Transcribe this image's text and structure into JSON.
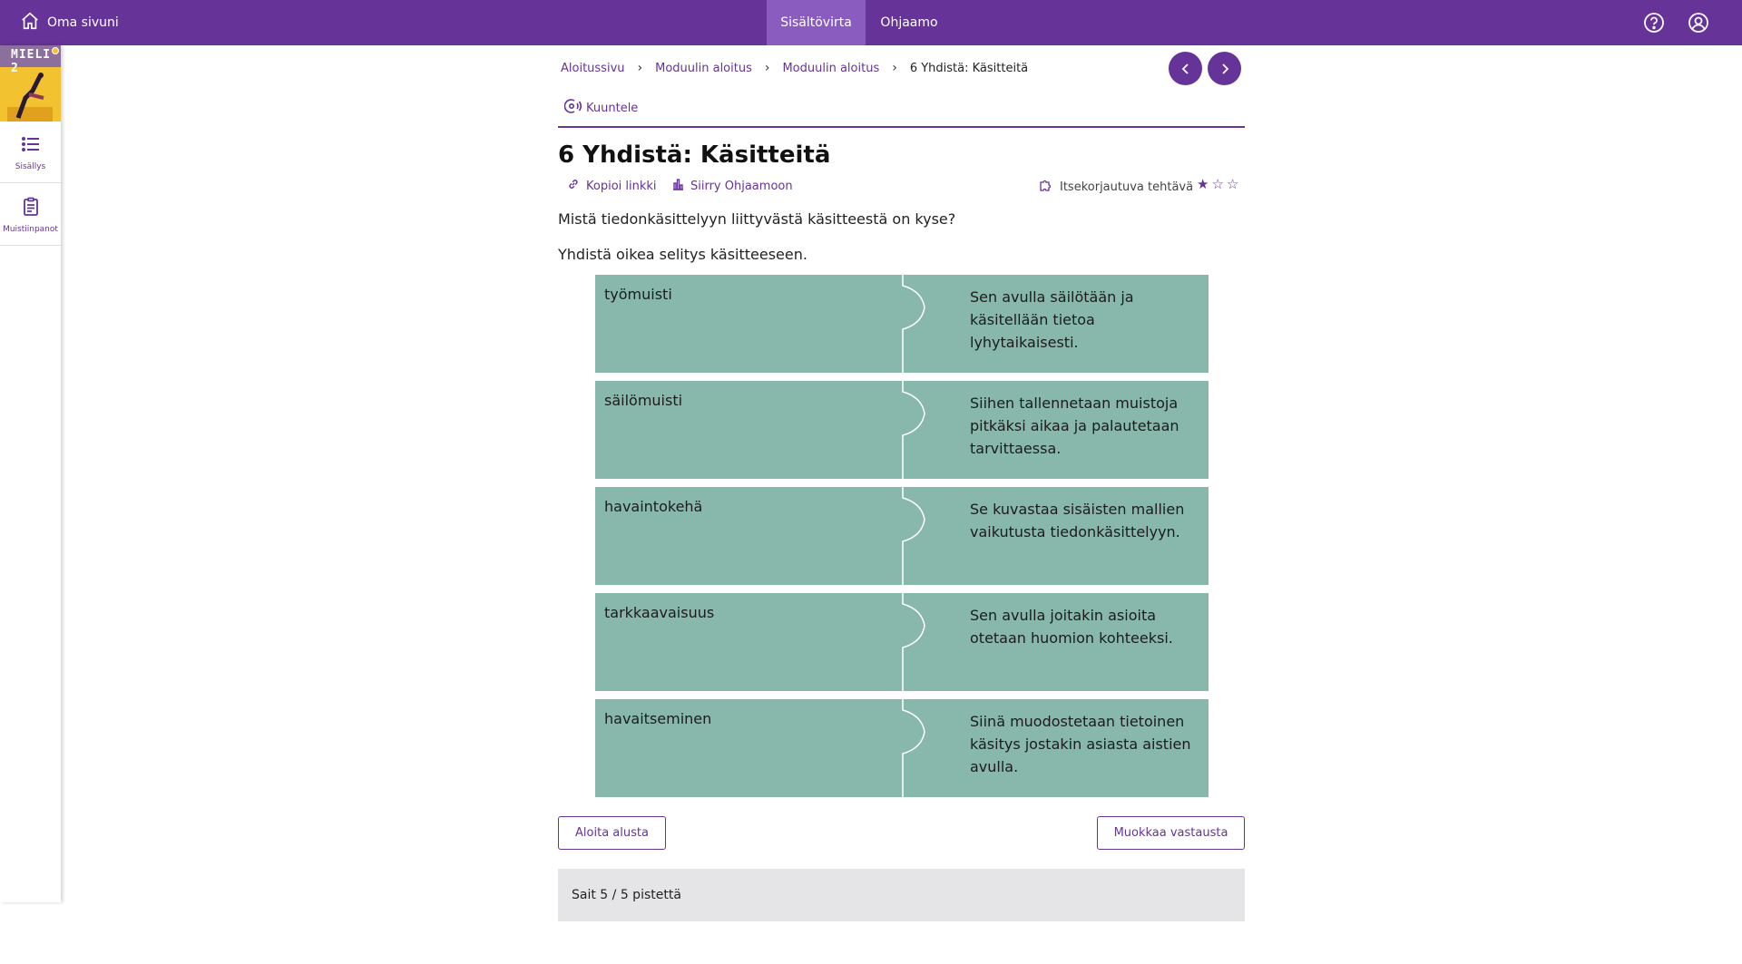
{
  "topbar": {
    "home_label": "Oma sivuni",
    "tabs": [
      {
        "label": "Sisältövirta",
        "active": true
      },
      {
        "label": "Ohjaamo",
        "active": false
      }
    ],
    "icons": [
      "help-icon",
      "account-icon"
    ]
  },
  "sidebar": {
    "cover_title": "MIELI 2",
    "items": [
      {
        "label": "Sisällys",
        "icon": "list-icon"
      },
      {
        "label": "Muistiinpanot",
        "icon": "notes-icon"
      }
    ]
  },
  "breadcrumb": {
    "items": [
      "Aloitussivu",
      "Moduulin aloitus",
      "Moduulin aloitus"
    ],
    "current": "6 Yhdistä: Käsitteitä"
  },
  "listen_label": "Kuuntele",
  "page": {
    "title": "6 Yhdistä: Käsitteitä",
    "copy_link": "Kopioi linkki",
    "go_ohjaamo": "Siirry Ohjaamoon",
    "self_check": "Itsekorjautuva tehtävä",
    "stars_filled": 1,
    "stars_total": 3,
    "question": "Mistä tiedonkäsittelyyn liittyvästä käsitteestä on kyse?",
    "instruction": "Yhdistä oikea selitys käsitteeseen."
  },
  "matches": [
    {
      "term": "työmuisti",
      "definition": "Sen avulla säilötään ja käsitellään tietoa lyhytaikaisesti."
    },
    {
      "term": "säilömuisti",
      "definition": "Siihen tallennetaan muistoja pitkäksi aikaa ja palautetaan tarvittaessa."
    },
    {
      "term": "havaintokehä",
      "definition": "Se kuvastaa sisäisten mallien vaikutusta tiedonkäsittelyyn."
    },
    {
      "term": "tarkkaavaisuus",
      "definition": "Sen avulla joitakin asioita otetaan huomion kohteeksi."
    },
    {
      "term": "havaitseminen",
      "definition": "Siinä muodostetaan tietoinen käsitys jostakin asiasta aistien avulla."
    }
  ],
  "buttons": {
    "restart": "Aloita alusta",
    "edit_answer": "Muokkaa vastausta"
  },
  "score_text": "Sait 5 / 5 pistettä",
  "colors": {
    "brand": "#663399",
    "match_bg": "#87b8ab",
    "score_bg": "#e5e5e7"
  }
}
